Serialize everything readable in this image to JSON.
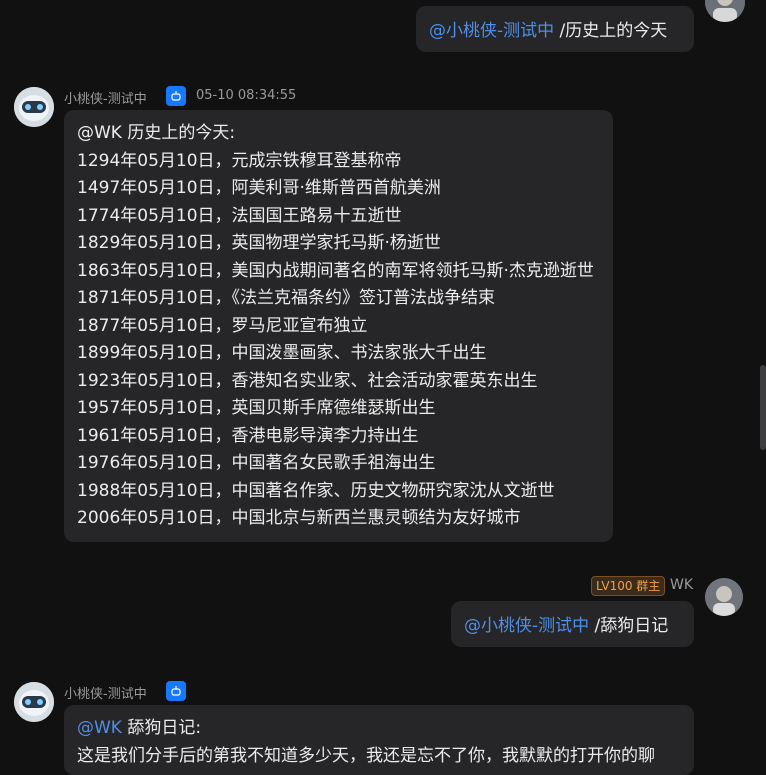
{
  "messages": {
    "m1": {
      "mention": "@小桃侠-测试中",
      "command": " /历史上的今天"
    },
    "m2": {
      "sender": "小桃侠-测试中",
      "time": "05-10 08:34:55",
      "header": "@WK 历史上的今天:",
      "lines": [
        "1294年05月10日，元成宗铁穆耳登基称帝",
        "1497年05月10日，阿美利哥·维斯普西首航美洲",
        "1774年05月10日，法国国王路易十五逝世",
        "1829年05月10日，英国物理学家托马斯·杨逝世",
        "1863年05月10日，美国内战期间著名的南军将领托马斯·杰克逊逝世",
        "1871年05月10日，《法兰克福条约》签订普法战争结束",
        "1877年05月10日，罗马尼亚宣布独立",
        "1899年05月10日，中国泼墨画家、书法家张大千出生",
        "1923年05月10日，香港知名实业家、社会活动家霍英东出生",
        "1957年05月10日，英国贝斯手席德维瑟斯出生",
        "1961年05月10日，香港电影导演李力持出生",
        "1976年05月10日，中国著名女民歌手祖海出生",
        "1988年05月10日，中国著名作家、历史文物研究家沈从文逝世",
        "2006年05月10日，中国北京与新西兰惠灵顿结为友好城市"
      ]
    },
    "m3": {
      "level_badge": "LV100 群主",
      "sender": "WK",
      "mention": "@小桃侠-测试中",
      "command": " /舔狗日记"
    },
    "m4": {
      "sender": "小桃侠-测试中",
      "mention": "@WK",
      "header_rest": " 舔狗日记:",
      "partial_line": "这是我们分手后的第我不知道多少天，我还是忘不了你，我默默的打开你的聊"
    }
  },
  "icons": {
    "bot_badge": "robot-icon",
    "bot_avatar": "robot-avatar",
    "user_avatar": "user-photo-avatar"
  },
  "colors": {
    "background": "#111112",
    "bubble": "#262628",
    "mention": "#4f8fe8",
    "bot_badge": "#1677ff",
    "level_badge_text": "#f0a04a"
  }
}
